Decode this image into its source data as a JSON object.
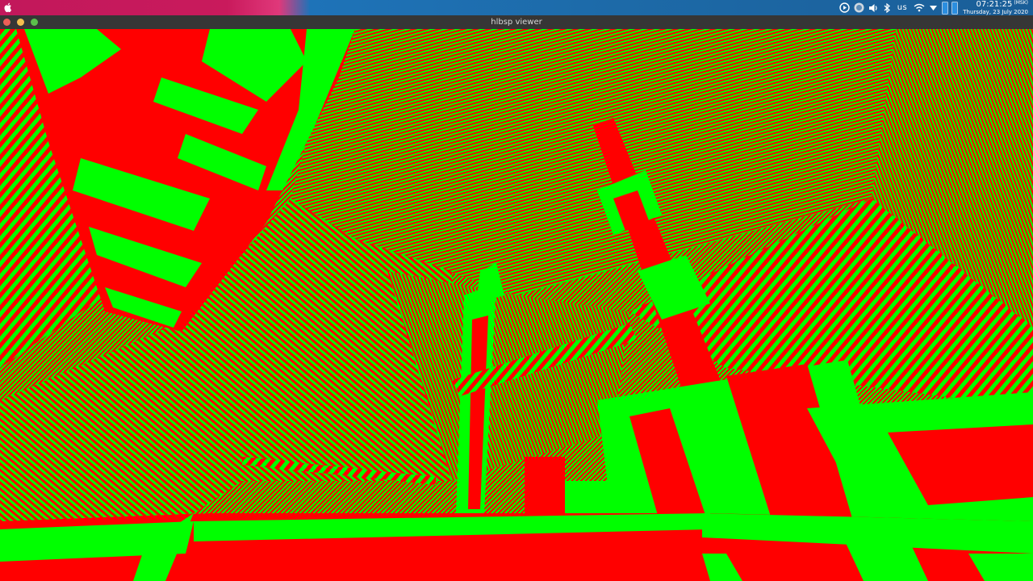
{
  "system_bar": {
    "keyboard_layout": "us",
    "clock": {
      "time": "07:21:25",
      "timezone": "(MSK)",
      "date": "Thursday, 23 July 2020"
    },
    "icons": [
      "apple-icon",
      "play-circle-icon",
      "app-icon",
      "volume-icon",
      "bluetooth-icon",
      "wifi-icon",
      "triangle-down-icon",
      "battery-icon",
      "battery-icon"
    ]
  },
  "window": {
    "title": "hlbsp viewer"
  },
  "colors": {
    "red": "#ff0000",
    "green": "#00ff00",
    "titlebar": "#363636"
  }
}
